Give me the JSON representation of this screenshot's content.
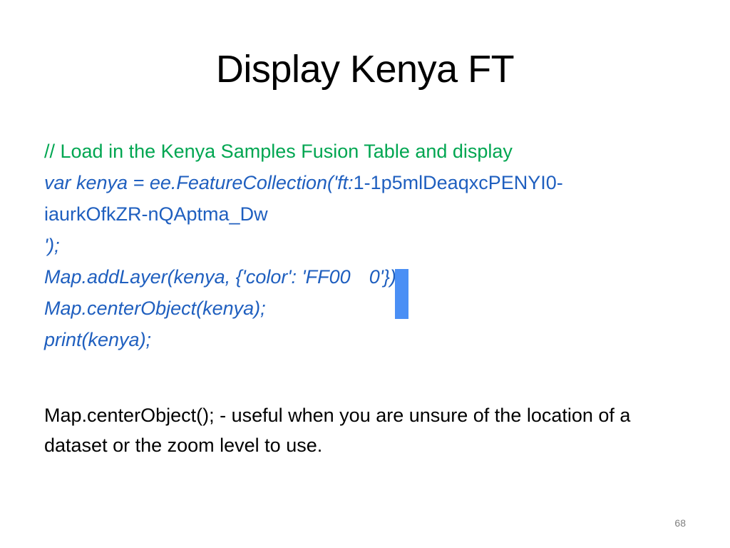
{
  "slide": {
    "title": "Display Kenya FT",
    "code_lines": {
      "comment": "// Load in the Kenya Samples Fusion Table and display",
      "var_prefix": "var kenya = ee.FeatureCollection('ft:",
      "var_id_part1": "1-1p5mlDeaqxcPENYI0-",
      "var_id_part2": "iaurkOfkZR-nQAptma_Dw",
      "var_close": "');",
      "add_layer": "Map.addLayer(kenya, {'color': 'FF00",
      "add_layer_tail": "0'});",
      "center_object": "Map.centerObject(kenya);",
      "print": "print(kenya);"
    },
    "note": "Map.centerObject(); - useful when you are unsure of the location of a dataset or the zoom level to use.",
    "page_number": "68"
  },
  "colors": {
    "comment": "#00a651",
    "code": "#1f5fbf",
    "cursor": "#4a8ff5",
    "text": "#000000"
  }
}
